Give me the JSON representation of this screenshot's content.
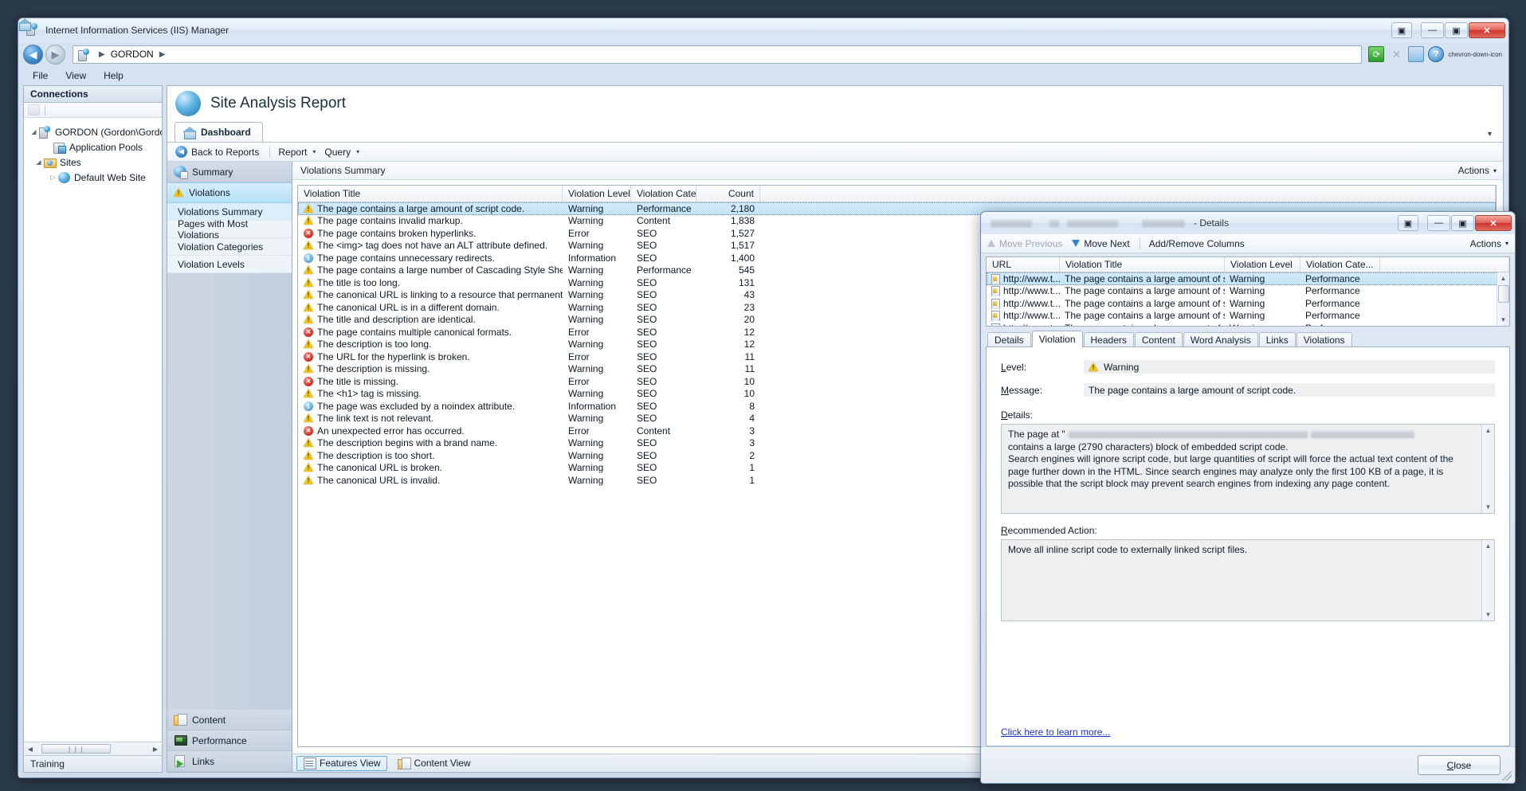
{
  "window": {
    "title": "Internet Information Services (IIS) Manager",
    "icon": "iis-server-icon",
    "buttons": {
      "extra": "▣",
      "minimize": "—",
      "maximize": "▣",
      "close": "✕"
    }
  },
  "address_bar": {
    "back_glyph": "◀",
    "forward_glyph": "▶",
    "breadcrumb_icon": "server-icon",
    "breadcrumb": [
      "GORDON"
    ],
    "separator": "▶",
    "icons": [
      "refresh-icon",
      "stop-icon",
      "home-icon",
      "help-icon",
      "chevron-down-icon"
    ],
    "refresh_glyph": "⟳",
    "stop_glyph": "✕",
    "help_glyph": "?"
  },
  "menu": {
    "items": [
      "File",
      "View",
      "Help"
    ]
  },
  "connections": {
    "header": "Connections",
    "tree": [
      {
        "label": "GORDON (Gordon\\Gordon)",
        "icon": "server-icon",
        "indent": 0,
        "twisty": "expanded"
      },
      {
        "label": "Application Pools",
        "icon": "app-pools-icon",
        "indent": 1,
        "twisty": "none"
      },
      {
        "label": "Sites",
        "icon": "sites-folder-icon",
        "indent": 1,
        "twisty": "expanded"
      },
      {
        "label": "Default Web Site",
        "icon": "web-site-globe-icon",
        "indent": 2,
        "twisty": "collapsed"
      }
    ],
    "scroll_thumb_glyph": "❘❘❘",
    "left_arrow": "◀",
    "right_arrow": "▶"
  },
  "status_bar": {
    "text": "Training"
  },
  "report": {
    "title": "Site Analysis Report",
    "icon": "site-analysis-icon",
    "tabs": [
      {
        "label": "Dashboard",
        "icon": "dashboard-home-icon",
        "active": true
      }
    ],
    "tab_caret": "▾",
    "toolbar": {
      "back_to_reports": "Back to Reports",
      "report_menu": "Report",
      "query_menu": "Query",
      "caret": "▾"
    },
    "nav_top": [
      {
        "label": "Summary",
        "icon": "summary-icon",
        "selected": false,
        "type": "group"
      },
      {
        "label": "Violations",
        "icon": "warning-icon",
        "selected": true,
        "type": "group"
      },
      {
        "label": "Violations Summary",
        "icon": "",
        "selected": true,
        "type": "sub"
      },
      {
        "label": "Pages with Most Violations",
        "icon": "",
        "selected": false,
        "type": "sub"
      },
      {
        "label": "Violation Categories",
        "icon": "",
        "selected": false,
        "type": "sub"
      },
      {
        "label": "Violation Levels",
        "icon": "",
        "selected": false,
        "type": "sub"
      }
    ],
    "nav_bottom": [
      {
        "label": "Content",
        "icon": "content-icon"
      },
      {
        "label": "Performance",
        "icon": "performance-icon"
      },
      {
        "label": "Links",
        "icon": "links-icon"
      }
    ]
  },
  "grid": {
    "caption": "Violations Summary",
    "actions_label": "Actions",
    "actions_caret": "▾",
    "columns": [
      "Violation Title",
      "Violation Level",
      "Violation Cate...",
      "Count"
    ],
    "rows": [
      {
        "severity": "warn",
        "title": "The page contains a large amount of script code.",
        "level": "Warning",
        "category": "Performance",
        "count": "2,180",
        "selected": true
      },
      {
        "severity": "warn",
        "title": "The page contains invalid markup.",
        "level": "Warning",
        "category": "Content",
        "count": "1,838",
        "selected": false
      },
      {
        "severity": "err",
        "title": "The page contains broken hyperlinks.",
        "level": "Error",
        "category": "SEO",
        "count": "1,527",
        "selected": false
      },
      {
        "severity": "warn",
        "title": "The <img> tag does not have an ALT attribute defined.",
        "level": "Warning",
        "category": "SEO",
        "count": "1,517",
        "selected": false
      },
      {
        "severity": "info",
        "title": "The page contains unnecessary redirects.",
        "level": "Information",
        "category": "SEO",
        "count": "1,400",
        "selected": false
      },
      {
        "severity": "warn",
        "title": "The page contains  a large number of Cascading Style Sheet (CSS) de...",
        "level": "Warning",
        "category": "Performance",
        "count": "545",
        "selected": false
      },
      {
        "severity": "warn",
        "title": "The title is too long.",
        "level": "Warning",
        "category": "SEO",
        "count": "131",
        "selected": false
      },
      {
        "severity": "warn",
        "title": "The canonical URL is linking to a resource that permanently moved.",
        "level": "Warning",
        "category": "SEO",
        "count": "43",
        "selected": false
      },
      {
        "severity": "warn",
        "title": "The canonical URL is in a different domain.",
        "level": "Warning",
        "category": "SEO",
        "count": "23",
        "selected": false
      },
      {
        "severity": "warn",
        "title": "The title and description are identical.",
        "level": "Warning",
        "category": "SEO",
        "count": "20",
        "selected": false
      },
      {
        "severity": "err",
        "title": "The page contains multiple canonical formats.",
        "level": "Error",
        "category": "SEO",
        "count": "12",
        "selected": false
      },
      {
        "severity": "warn",
        "title": "The description is too long.",
        "level": "Warning",
        "category": "SEO",
        "count": "12",
        "selected": false
      },
      {
        "severity": "err",
        "title": "The URL for the hyperlink is broken.",
        "level": "Error",
        "category": "SEO",
        "count": "11",
        "selected": false
      },
      {
        "severity": "warn",
        "title": "The description is missing.",
        "level": "Warning",
        "category": "SEO",
        "count": "11",
        "selected": false
      },
      {
        "severity": "err",
        "title": "The title is missing.",
        "level": "Error",
        "category": "SEO",
        "count": "10",
        "selected": false
      },
      {
        "severity": "warn",
        "title": "The <h1> tag is missing.",
        "level": "Warning",
        "category": "SEO",
        "count": "10",
        "selected": false
      },
      {
        "severity": "info",
        "title": "The page was excluded by a noindex attribute.",
        "level": "Information",
        "category": "SEO",
        "count": "8",
        "selected": false
      },
      {
        "severity": "warn",
        "title": "The link text is not relevant.",
        "level": "Warning",
        "category": "SEO",
        "count": "4",
        "selected": false
      },
      {
        "severity": "err",
        "title": "An unexpected error has occurred.",
        "level": "Error",
        "category": "Content",
        "count": "3",
        "selected": false
      },
      {
        "severity": "warn",
        "title": "The description begins with a brand name.",
        "level": "Warning",
        "category": "SEO",
        "count": "3",
        "selected": false
      },
      {
        "severity": "warn",
        "title": "The description is too short.",
        "level": "Warning",
        "category": "SEO",
        "count": "2",
        "selected": false
      },
      {
        "severity": "warn",
        "title": "The canonical URL is broken.",
        "level": "Warning",
        "category": "SEO",
        "count": "1",
        "selected": false
      },
      {
        "severity": "warn",
        "title": "The canonical URL is invalid.",
        "level": "Warning",
        "category": "SEO",
        "count": "1",
        "selected": false
      }
    ]
  },
  "views_bar": {
    "features_view": "Features View",
    "content_view": "Content View"
  },
  "dialog": {
    "title_suffix": "- Details",
    "title_redacted": true,
    "buttons": {
      "extra": "▣",
      "minimize": "—",
      "maximize": "▣",
      "close": "✕"
    },
    "toolbar": {
      "move_previous": "Move Previous",
      "move_next": "Move Next",
      "add_remove_columns": "Add/Remove Columns",
      "actions": "Actions",
      "actions_caret": "▾"
    },
    "grid": {
      "columns": [
        "URL",
        "Violation Title",
        "Violation Level",
        "Violation Cate..."
      ],
      "rows": [
        {
          "url": "http://www.t...",
          "title": "The page contains a large amount of script co...",
          "level": "Warning",
          "category": "Performance",
          "selected": true
        },
        {
          "url": "http://www.t...",
          "title": "The page contains a large amount of script co...",
          "level": "Warning",
          "category": "Performance",
          "selected": false
        },
        {
          "url": "http://www.t...",
          "title": "The page contains a large amount of script co...",
          "level": "Warning",
          "category": "Performance",
          "selected": false
        },
        {
          "url": "http://www.t...",
          "title": "The page contains a large amount of script co...",
          "level": "Warning",
          "category": "Performance",
          "selected": false
        },
        {
          "url": "http://www.t...",
          "title": "The page contains a large amount of script co...",
          "level": "Warning",
          "category": "Performance",
          "selected": false
        }
      ],
      "scroll_up": "▲",
      "scroll_down": "▼"
    },
    "tabs": [
      {
        "label": "Details",
        "active": false
      },
      {
        "label": "Violation",
        "active": true
      },
      {
        "label": "Headers",
        "active": false
      },
      {
        "label": "Content",
        "active": false
      },
      {
        "label": "Word Analysis",
        "active": false
      },
      {
        "label": "Links",
        "active": false
      },
      {
        "label": "Violations",
        "active": false
      }
    ],
    "fields": {
      "level_label": "Level:",
      "level_value": "Warning",
      "level_icon": "warning-icon",
      "message_label": "Message:",
      "message_value": "The page contains a large amount of script code.",
      "details_label": "Details:",
      "details_prefix": "The page at \"",
      "details_text": "contains a large (2790 characters) block of embedded script code.\nSearch engines will ignore script code, but large quantities of script will force the actual text content of the page further down in the HTML. Since search engines may analyze only the first 100 KB of a page, it is possible that the script block may prevent search engines from indexing any page content.",
      "action_label": "Recommended Action:",
      "action_text": "Move all inline script code to externally linked script files."
    },
    "learn_more": "Click here to learn more...",
    "close_button": "Close",
    "scroll_up": "▲",
    "scroll_down": "▼"
  }
}
